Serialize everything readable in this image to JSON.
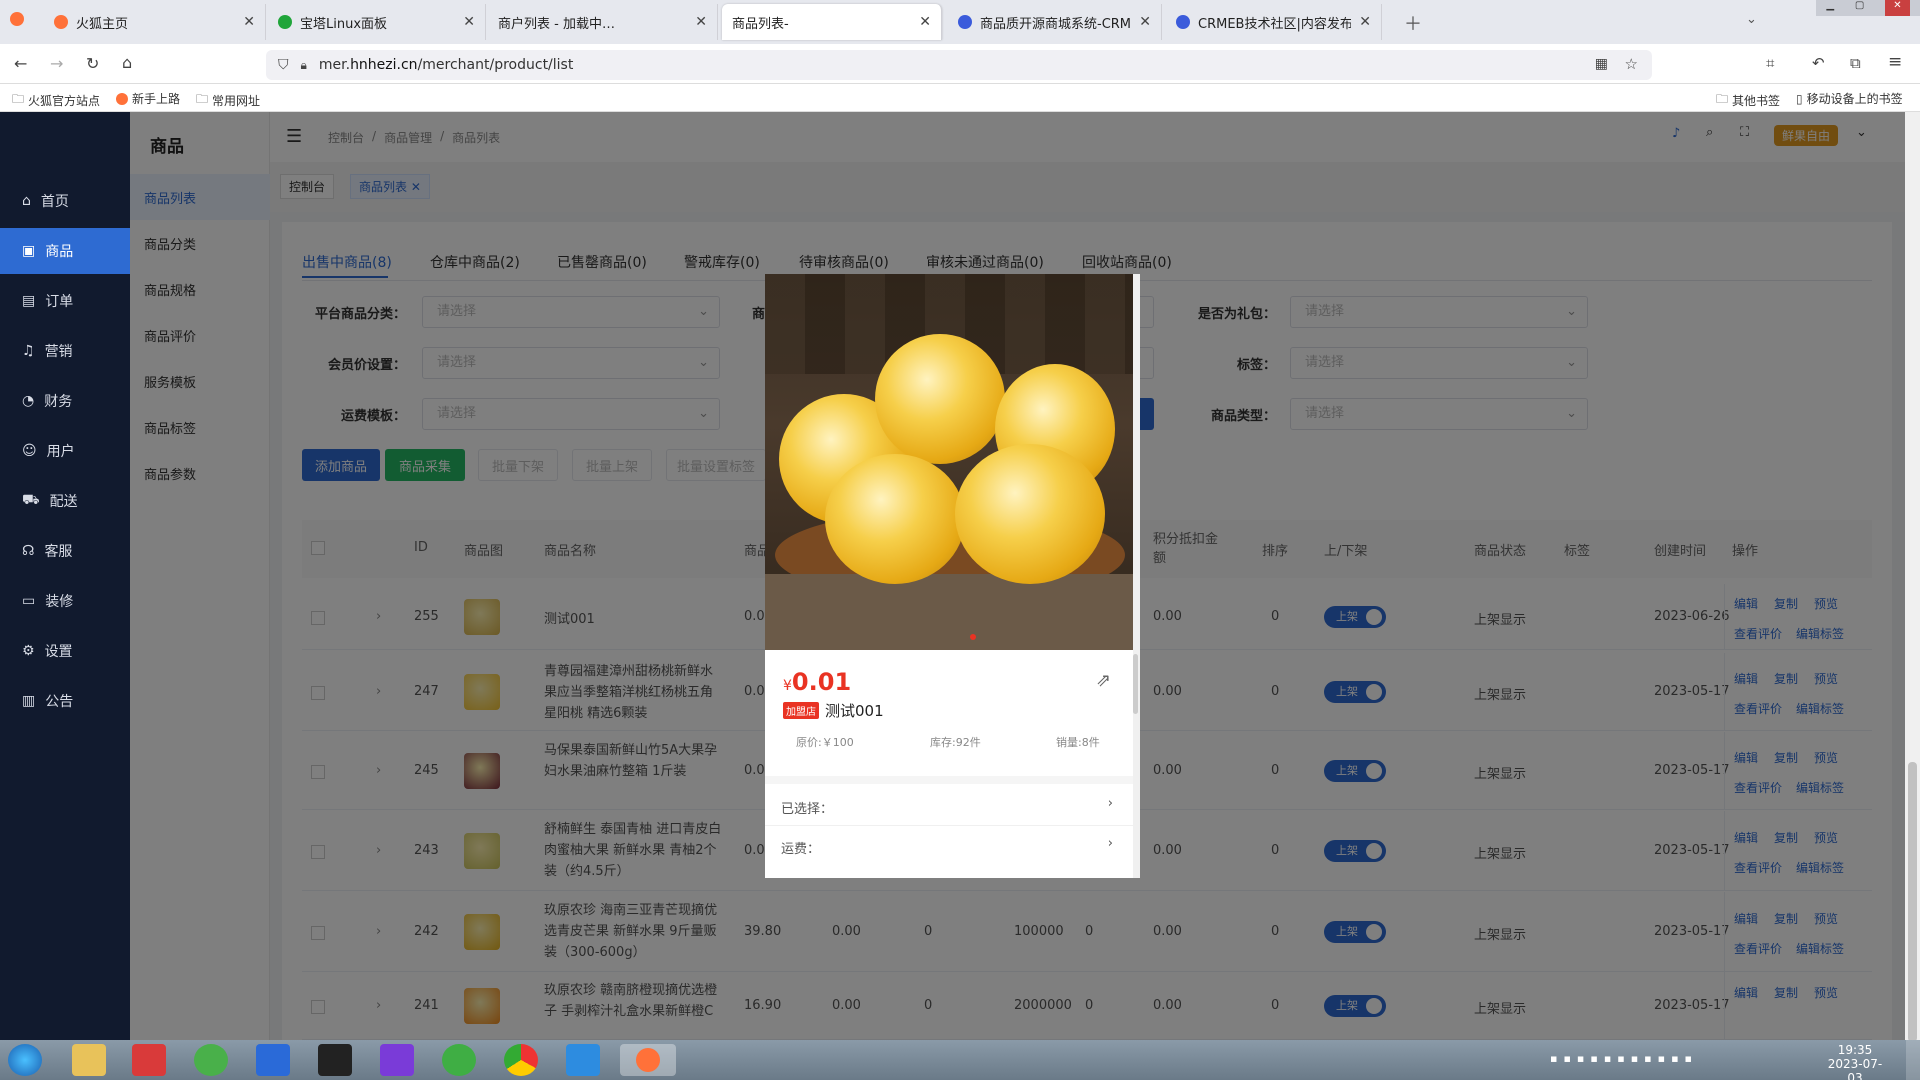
{
  "browser": {
    "tabs": [
      {
        "title": "火狐主页",
        "color": "#ff7139"
      },
      {
        "title": "宝塔Linux面板",
        "color": "#20a53a"
      },
      {
        "title": "商户列表 - 加载中…",
        "color": "#999999"
      },
      {
        "title": "商品列表-",
        "color": "#ffffff"
      },
      {
        "title": "商品质开源商城系统-CRMEB官",
        "color": "#3b5bdb"
      },
      {
        "title": "CRMEB技术社区|内容发布-CRM",
        "color": "#3b5bdb"
      }
    ],
    "url_prefix": "mer.",
    "url_domain": "hnhezi.cn",
    "url_path": "/merchant/product/list",
    "bookmarks": [
      "火狐官方站点",
      "新手上路",
      "常用网址"
    ],
    "bookmarks_right": [
      "其他书签",
      "移动设备上的书签"
    ]
  },
  "sidebar": {
    "items": [
      {
        "label": "首页",
        "icon": "home-icon"
      },
      {
        "label": "商品",
        "icon": "bag-icon"
      },
      {
        "label": "订单",
        "icon": "document-icon"
      },
      {
        "label": "营销",
        "icon": "bell-icon"
      },
      {
        "label": "财务",
        "icon": "pie-icon"
      },
      {
        "label": "用户",
        "icon": "user-icon"
      },
      {
        "label": "配送",
        "icon": "truck-icon"
      },
      {
        "label": "客服",
        "icon": "headset-icon"
      },
      {
        "label": "装修",
        "icon": "brush-icon"
      },
      {
        "label": "设置",
        "icon": "gear-icon"
      },
      {
        "label": "公告",
        "icon": "notice-icon"
      }
    ]
  },
  "submenu": {
    "title": "商品",
    "items": [
      "商品列表",
      "商品分类",
      "商品规格",
      "商品评价",
      "服务模板",
      "商品标签",
      "商品参数"
    ]
  },
  "header": {
    "breadcrumb": [
      "控制台",
      "商品管理",
      "商品列表"
    ],
    "user": "鲜果自由",
    "tags": [
      "控制台",
      "商品列表"
    ]
  },
  "product_tabs": [
    "出售中商品(8)",
    "仓库中商品(2)",
    "已售罄商品(0)",
    "警戒库存(0)",
    "待审核商品(0)",
    "审核未通过商品(0)",
    "回收站商品(0)"
  ],
  "filters": {
    "platform_category": "平台商品分类：",
    "member_price": "会员价设置：",
    "shipping_template": "运费模板：",
    "is_gift": "是否为礼包：",
    "tag": "标签：",
    "product_type": "商品类型：",
    "placeholder": "请选择",
    "partial_label": "商"
  },
  "actions": {
    "add": "添加商品",
    "collect": "商品采集",
    "batch_off": "批量下架",
    "batch_on": "批量上架",
    "batch_tag": "批量设置标签"
  },
  "table": {
    "headers": [
      "ID",
      "商品图",
      "商品名称",
      "商品",
      "积分抵扣金",
      "额",
      "排序",
      "上/下架",
      "商品状态",
      "标签",
      "创建时间",
      "操作"
    ],
    "rows": [
      {
        "id": "255",
        "name": [
          "测试001"
        ],
        "price": "0.0",
        "col2": "",
        "col3": "",
        "col4": "",
        "col5": "",
        "points": "0.00",
        "sort": "0",
        "toggle": "上架",
        "status": "上架显示",
        "date": "2023-06-26"
      },
      {
        "id": "247",
        "name": [
          "青尊园福建漳州甜杨桃新鲜水",
          "果应当季整箱洋桃红杨桃五角",
          "星阳桃 精选6颗装"
        ],
        "price": "0.0",
        "col2": "",
        "col3": "",
        "col4": "",
        "col5": "",
        "points": "0.00",
        "sort": "0",
        "toggle": "上架",
        "status": "上架显示",
        "date": "2023-05-17"
      },
      {
        "id": "245",
        "name": [
          "马保果泰国新鲜山竹5A大果孕",
          "妇水果油麻竹整箱 1斤装"
        ],
        "price": "0.0",
        "col2": "",
        "col3": "",
        "col4": "",
        "col5": "",
        "points": "0.00",
        "sort": "0",
        "toggle": "上架",
        "status": "上架显示",
        "date": "2023-05-17"
      },
      {
        "id": "243",
        "name": [
          "舒楠鲜生 泰国青柚 进口青皮白",
          "肉蜜柚大果 新鲜水果 青柚2个",
          "装（约4.5斤）"
        ],
        "price": "0.0",
        "col2": "",
        "col3": "",
        "col4": "",
        "col5": "",
        "points": "0.00",
        "sort": "0",
        "toggle": "上架",
        "status": "上架显示",
        "date": "2023-05-17"
      },
      {
        "id": "242",
        "name": [
          "玖原农珍 海南三亚青芒现摘优",
          "选青皮芒果 新鲜水果 9斤量贩",
          "装（300-600g）"
        ],
        "price": "39.80",
        "col2": "0.00",
        "col3": "0",
        "col4": "100000",
        "col5": "0",
        "points": "0.00",
        "sort": "0",
        "toggle": "上架",
        "status": "上架显示",
        "date": "2023-05-17"
      },
      {
        "id": "241",
        "name": [
          "玖原农珍 赣南脐橙现摘优选橙",
          "子 手剥榨汁礼盒水果新鲜橙C"
        ],
        "price": "16.90",
        "col2": "0.00",
        "col3": "0",
        "col4": "2000000",
        "col5": "0",
        "points": "0.00",
        "sort": "0",
        "toggle": "上架",
        "status": "上架显示",
        "date": "2023-05-17"
      }
    ],
    "ops": [
      "编辑",
      "复制",
      "预览",
      "查看评价",
      "编辑标签"
    ]
  },
  "preview": {
    "currency": "¥",
    "price": "0.01",
    "badge": "加盟店",
    "name": "测试001",
    "original_price": "原价:￥100",
    "stock": "库存:92件",
    "sales": "销量:8件",
    "selected_label": "已选择：",
    "shipping_label": "运费："
  },
  "taskbar": {
    "time": "19:35",
    "date": "2023-07-03"
  }
}
